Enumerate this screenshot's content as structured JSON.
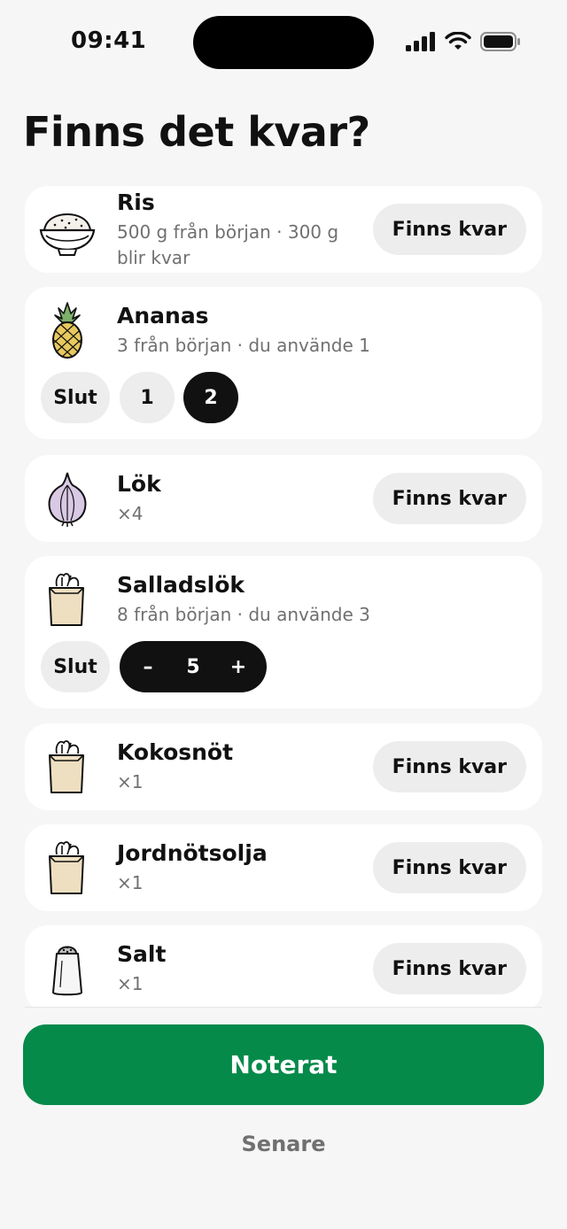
{
  "status_bar": {
    "time": "09:41"
  },
  "title": "Finns det kvar?",
  "items": [
    {
      "name": "Ris",
      "subtitle": "500 g från början · 300 g blir kvar",
      "icon": "rice-bowl-icon",
      "action": "Finns kvar"
    },
    {
      "name": "Ananas",
      "subtitle": "3 från början · du använde 1",
      "icon": "pineapple-icon",
      "options": [
        "Slut",
        "1",
        "2"
      ],
      "selected_option": "2"
    },
    {
      "name": "Lök",
      "subtitle": "×4",
      "icon": "onion-icon",
      "action": "Finns kvar"
    },
    {
      "name": "Salladslök",
      "subtitle": "8 från början · du använde 3",
      "icon": "grocery-bag-icon",
      "out_label": "Slut",
      "stepper": {
        "minus": "–",
        "value": "5",
        "plus": "+"
      }
    },
    {
      "name": "Kokosnöt",
      "subtitle": "×1",
      "icon": "grocery-bag-icon",
      "action": "Finns kvar"
    },
    {
      "name": "Jordnötsolja",
      "subtitle": "×1",
      "icon": "grocery-bag-icon",
      "action": "Finns kvar"
    },
    {
      "name": "Salt",
      "subtitle": "×1",
      "icon": "salt-shaker-icon",
      "action": "Finns kvar"
    }
  ],
  "primary_button": "Noterat",
  "secondary_button": "Senare",
  "colors": {
    "accent": "#058a4a",
    "background": "#f6f6f6",
    "card": "#ffffff",
    "chip": "#ededed",
    "selected": "#111111"
  }
}
